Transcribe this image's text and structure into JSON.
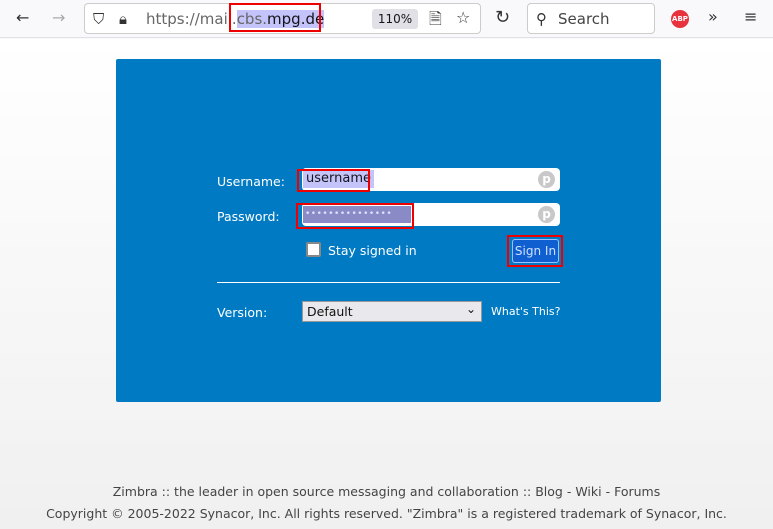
{
  "browser": {
    "url_prefix": "https://mail.",
    "url_selected": "cbs.",
    "url_domain": "mpg.de",
    "zoom": "110%",
    "search_placeholder": "Search",
    "abp_label": "ABP"
  },
  "login": {
    "username_label": "Username:",
    "username_value": "username",
    "password_label": "Password:",
    "password_value": "•••••••••••••••",
    "stay_signed_in": "Stay signed in",
    "stay_signed_in_checked": false,
    "sign_in": "Sign In",
    "version_label": "Version:",
    "version_value": "Default",
    "whats_this": "What's This?"
  },
  "footer": {
    "line1_text": "Zimbra :: the leader in open source messaging and collaboration :: ",
    "links": [
      "Blog",
      "Wiki",
      "Forums"
    ],
    "sep": " - ",
    "copyright": "Copyright © 2005-2022 Synacor, Inc. All rights reserved. \"Zimbra\" is a registered trademark of Synacor, Inc."
  },
  "colors": {
    "panel": "#007ac2",
    "highlight": "#e00000"
  }
}
